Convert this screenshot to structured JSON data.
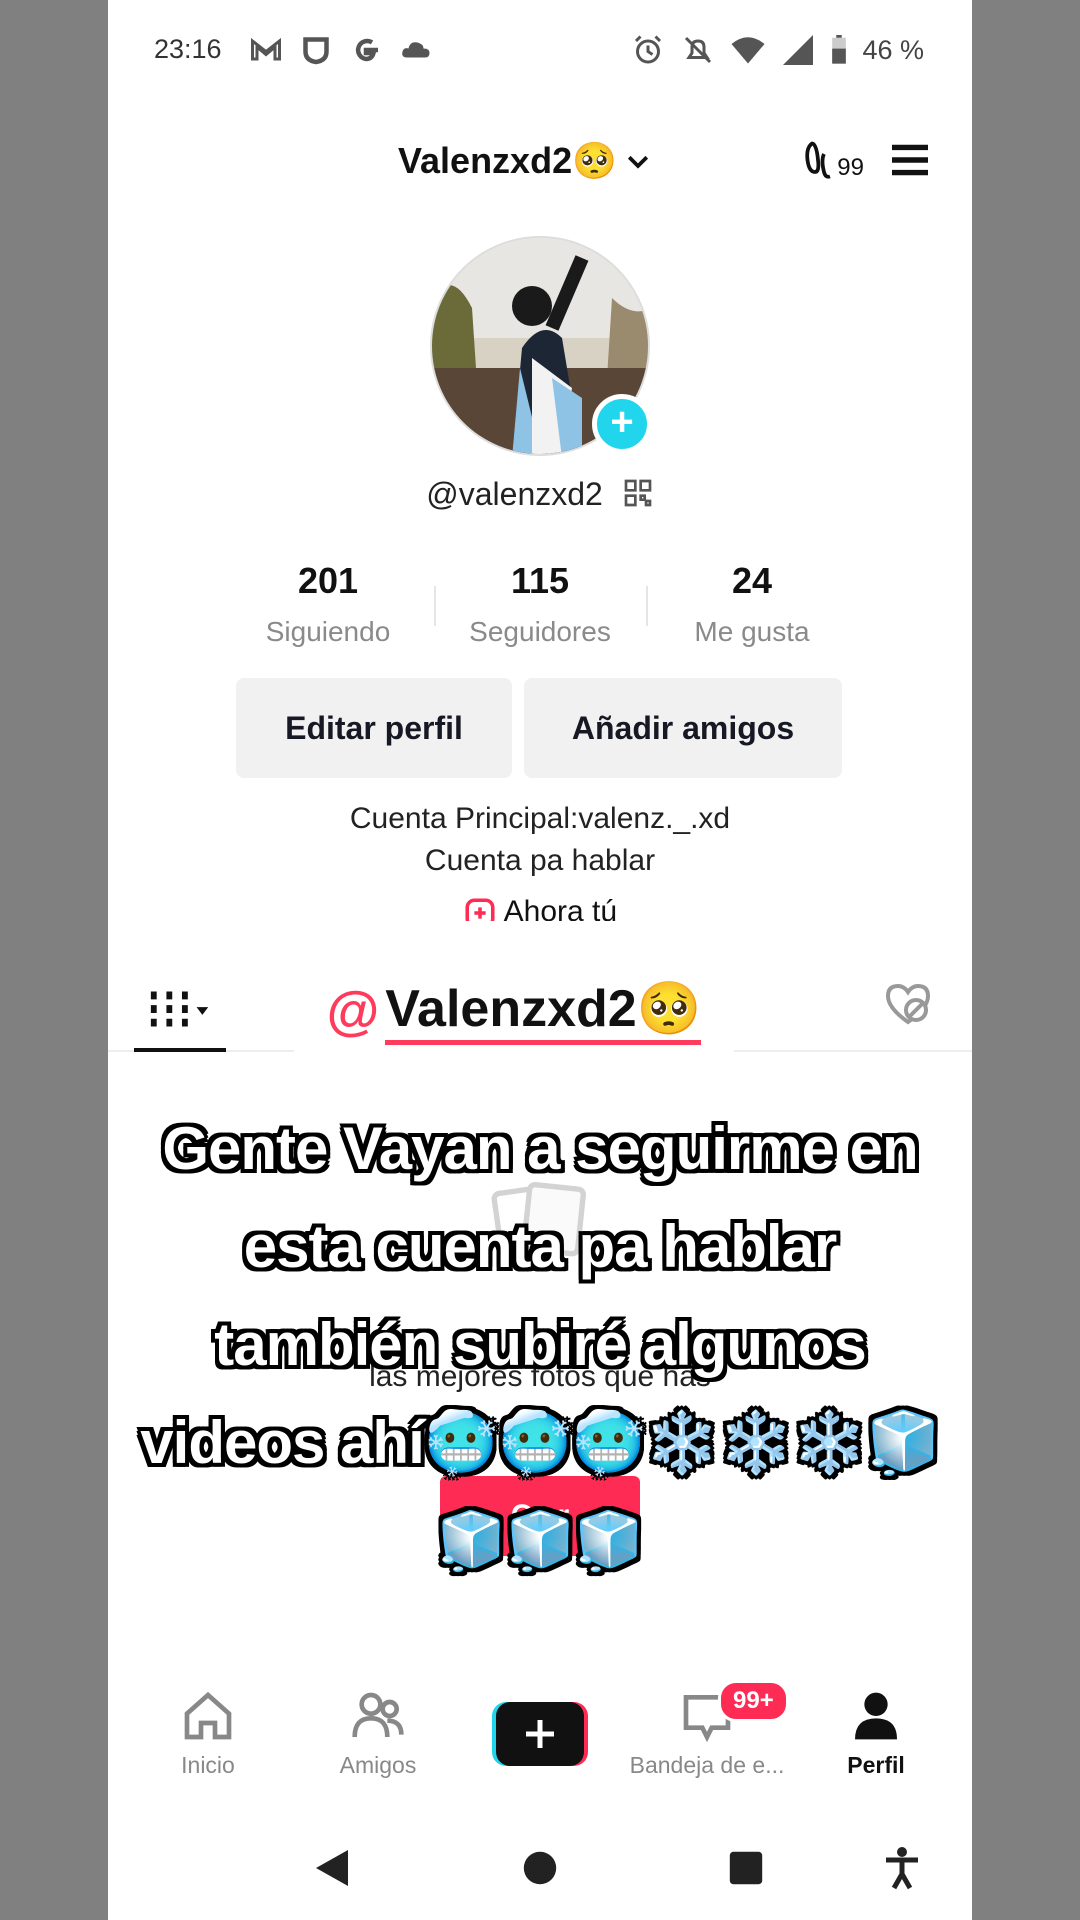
{
  "status_bar": {
    "time": "23:16",
    "battery": "46 %"
  },
  "header": {
    "title": "Valenzxd2🥺",
    "notifications_count": "99"
  },
  "profile": {
    "handle": "@valenzxd2",
    "stats": [
      {
        "value": "201",
        "label": "Siguiendo"
      },
      {
        "value": "115",
        "label": "Seguidores"
      },
      {
        "value": "24",
        "label": "Me gusta"
      }
    ],
    "edit_button": "Editar perfil",
    "add_friends_button": "Añadir amigos",
    "bio_line1": "Cuenta Principal:valenz._.xd",
    "bio_line2": "Cuenta pa hablar",
    "now_you": "Ahora tú"
  },
  "overlay": {
    "at": "@",
    "username": "Valenzxd2🥺",
    "caption_line1": "Gente Vayan a seguirme en",
    "caption_line2": "esta cuenta pa hablar",
    "caption_line3": "también subiré algunos",
    "caption_line4": "videos ahí🥶🥶🥶❄️❄️❄️🧊",
    "caption_line5": "🧊🧊🧊"
  },
  "empty_state": {
    "text": "las mejores fotos que has",
    "button": "Ca  r"
  },
  "bottom_nav": {
    "home": "Inicio",
    "friends": "Amigos",
    "inbox": "Bandeja de e...",
    "inbox_badge": "99+",
    "profile": "Perfil"
  },
  "colors": {
    "accent": "#fe2c55",
    "cyan": "#20d5ec"
  }
}
